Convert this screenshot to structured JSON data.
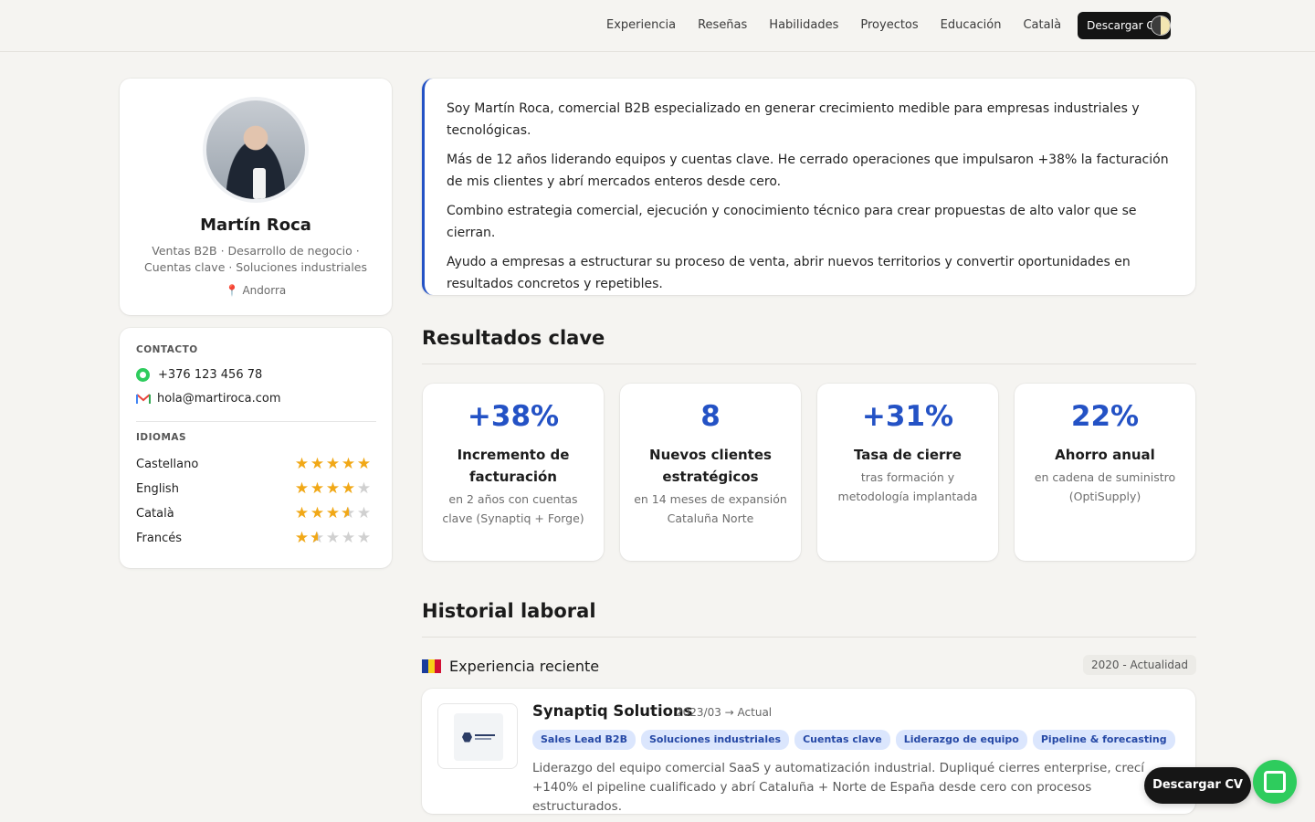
{
  "nav": {
    "links": [
      "Experiencia",
      "Reseñas",
      "Habilidades",
      "Proyectos",
      "Educación",
      "Català"
    ],
    "cta_label": "Descargar CV",
    "theme_icon": "half-moon-icon"
  },
  "profile": {
    "name": "Martín Roca",
    "role": "Ventas B2B · Desarrollo de negocio · Cuentas clave · Soluciones industriales",
    "location": "📍 Andorra"
  },
  "contact": {
    "label": "CONTACTO",
    "phone": "+376 123 456 78",
    "email": "hola@martiroca.com",
    "phone_icon": "whatsapp-icon",
    "email_icon": "gmail-icon"
  },
  "languages": {
    "label": "IDIOMAS",
    "items": [
      {
        "name": "Castellano",
        "rating": 5
      },
      {
        "name": "English",
        "rating": 4
      },
      {
        "name": "Català",
        "rating": 3.5
      },
      {
        "name": "Francés",
        "rating": 1.5
      }
    ],
    "max_rating": 5,
    "star_color": "#f1a817"
  },
  "about": {
    "paragraphs": [
      "Soy Martín Roca, comercial B2B especializado en generar crecimiento medible para empresas industriales y tecnológicas.",
      "Más de 12 años liderando equipos y cuentas clave. He cerrado operaciones que impulsaron +38% la facturación de mis clientes y abrí mercados enteros desde cero.",
      "Combino estrategia comercial, ejecución y conocimiento técnico para crear propuestas de alto valor que se cierran.",
      "Ayudo a empresas a estructurar su proceso de venta, abrir nuevos territorios y convertir oportunidades en resultados concretos y repetibles."
    ],
    "accent": "#2452c5"
  },
  "results": {
    "title": "Resultados clave",
    "items": [
      {
        "value": "+38%",
        "title": "Incremento de facturación",
        "sub": "en 2 años con cuentas clave (Synaptiq + Forge)"
      },
      {
        "value": "8",
        "title": "Nuevos clientes estratégicos",
        "sub": "en 14 meses de expansión Cataluña Norte"
      },
      {
        "value": "+31%",
        "title": "Tasa de cierre",
        "sub": "tras formación y metodología implantada"
      },
      {
        "value": "22%",
        "title": "Ahorro anual",
        "sub": "en cadena de suministro (OptiSupply)"
      }
    ]
  },
  "history": {
    "title": "Historial laboral",
    "group": {
      "title": "Experiencia reciente",
      "range": "2020 - Actualidad",
      "flag_icon": "andorra-flag-icon"
    },
    "jobs": [
      {
        "company": "Synaptiq Solutions",
        "dates": "2023/03 → Actual",
        "logo_icon": "synaptiq-logo",
        "tags": [
          "Sales Lead B2B",
          "Soluciones industriales",
          "Cuentas clave",
          "Liderazgo de equipo",
          "Pipeline & forecasting"
        ],
        "description": "Liderazgo del equipo comercial SaaS y automatización industrial. Dupliqué cierres enterprise, crecí +140% el pipeline cualificado y abrí Cataluña + Norte de España desde cero con procesos estructurados."
      }
    ]
  },
  "floating": {
    "cv_label": "Descargar CV",
    "chat_icon": "whatsapp-chat-icon",
    "chat_color": "#2ecc5d"
  }
}
